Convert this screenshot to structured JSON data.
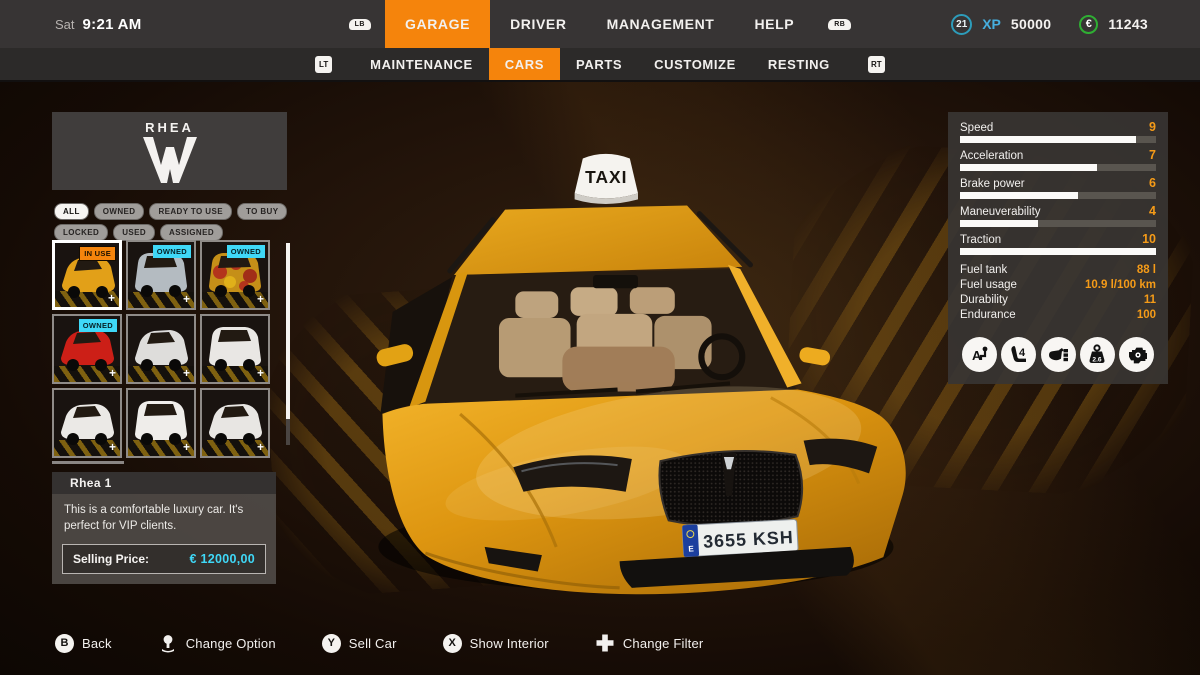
{
  "status_bar": {
    "day": "Sat",
    "time": "9:21 AM",
    "lb": "LB",
    "rb": "RB",
    "level": "21",
    "xp_label": "XP",
    "xp_value": "50000",
    "currency_symbol": "€",
    "money": "11243"
  },
  "main_nav": {
    "tabs": [
      {
        "label": "GARAGE",
        "active": true
      },
      {
        "label": "DRIVER",
        "active": false
      },
      {
        "label": "MANAGEMENT",
        "active": false
      },
      {
        "label": "HELP",
        "active": false
      }
    ]
  },
  "sub_nav": {
    "lt": "LT",
    "rt": "RT",
    "tabs": [
      {
        "label": "MAINTENANCE",
        "active": false
      },
      {
        "label": "CARS",
        "active": true
      },
      {
        "label": "PARTS",
        "active": false
      },
      {
        "label": "CUSTOMIZE",
        "active": false
      },
      {
        "label": "RESTING",
        "active": false
      }
    ]
  },
  "brand": {
    "name": "RHEA"
  },
  "filters": [
    {
      "label": "ALL",
      "active": true
    },
    {
      "label": "OWNED",
      "active": false
    },
    {
      "label": "READY TO USE",
      "active": false
    },
    {
      "label": "TO BUY",
      "active": false
    },
    {
      "label": "LOCKED",
      "active": false
    },
    {
      "label": "USED",
      "active": false
    },
    {
      "label": "ASSIGNED",
      "active": false
    }
  ],
  "garage": {
    "plus_glyph": "+",
    "thumbnails": [
      {
        "badge": "IN USE",
        "badge_type": "inuse",
        "selected": true,
        "body_color": "#e2a018",
        "type": "sedan",
        "camo": false
      },
      {
        "badge": "OWNED",
        "badge_type": "owned",
        "selected": false,
        "body_color": "#b4bbc1",
        "type": "van",
        "camo": false
      },
      {
        "badge": "OWNED",
        "badge_type": "owned",
        "selected": false,
        "body_color": "#c58f18",
        "type": "van",
        "camo": true
      },
      {
        "badge": "OWNED",
        "badge_type": "owned",
        "selected": false,
        "body_color": "#cc1f17",
        "type": "sedan",
        "camo": false
      },
      {
        "badge": "",
        "badge_type": "",
        "selected": false,
        "body_color": "#dedddb",
        "type": "sedan",
        "camo": false
      },
      {
        "badge": "",
        "badge_type": "",
        "selected": false,
        "body_color": "#e9e7e4",
        "type": "van",
        "camo": false
      },
      {
        "badge": "",
        "badge_type": "",
        "selected": false,
        "body_color": "#ebe9e6",
        "type": "sedan",
        "camo": false
      },
      {
        "badge": "",
        "badge_type": "",
        "selected": false,
        "body_color": "#efedea",
        "type": "van",
        "camo": false
      },
      {
        "badge": "",
        "badge_type": "",
        "selected": false,
        "body_color": "#e8e6e3",
        "type": "sedan",
        "camo": false
      }
    ]
  },
  "car_detail": {
    "name": "Rhea 1",
    "description": "This is a comfortable luxury car. It's perfect for VIP clients.",
    "selling_price_label": "Selling Price:",
    "selling_price_value": "€ 12000,00"
  },
  "vehicle": {
    "taxi_sign": "TAXI",
    "plate": "3655 KSH",
    "plate_country": "E"
  },
  "stats": {
    "max": 10,
    "bars": [
      {
        "label": "Speed",
        "value": 9
      },
      {
        "label": "Acceleration",
        "value": 7
      },
      {
        "label": "Brake power",
        "value": 6
      },
      {
        "label": "Maneuverability",
        "value": 4
      },
      {
        "label": "Traction",
        "value": 10
      }
    ],
    "specs": [
      {
        "label": "Fuel tank",
        "value": "88 l"
      },
      {
        "label": "Fuel usage",
        "value": "10.9 l/100 km"
      },
      {
        "label": "Durability",
        "value": "11"
      },
      {
        "label": "Endurance",
        "value": "100"
      }
    ],
    "features": [
      {
        "name": "transmission-icon",
        "sub": "A"
      },
      {
        "name": "seats-icon",
        "sub": "4"
      },
      {
        "name": "cargo-icon",
        "sub": ""
      },
      {
        "name": "weight-icon",
        "sub": "2.6"
      },
      {
        "name": "engine-icon",
        "sub": ""
      }
    ]
  },
  "controls": [
    {
      "icon": "b-button",
      "button": "B",
      "label": "Back"
    },
    {
      "icon": "left-stick-icon",
      "button": "",
      "label": "Change Option"
    },
    {
      "icon": "y-button",
      "button": "Y",
      "label": "Sell Car"
    },
    {
      "icon": "x-button",
      "button": "X",
      "label": "Show Interior"
    },
    {
      "icon": "dpad-icon",
      "button": "",
      "label": "Change Filter"
    }
  ],
  "colors": {
    "accent_orange": "#f5840c",
    "accent_cyan": "#3fd8f7",
    "xp_blue": "#46aede",
    "money_green": "#2fae33",
    "stat_value_orange": "#f59b18"
  }
}
